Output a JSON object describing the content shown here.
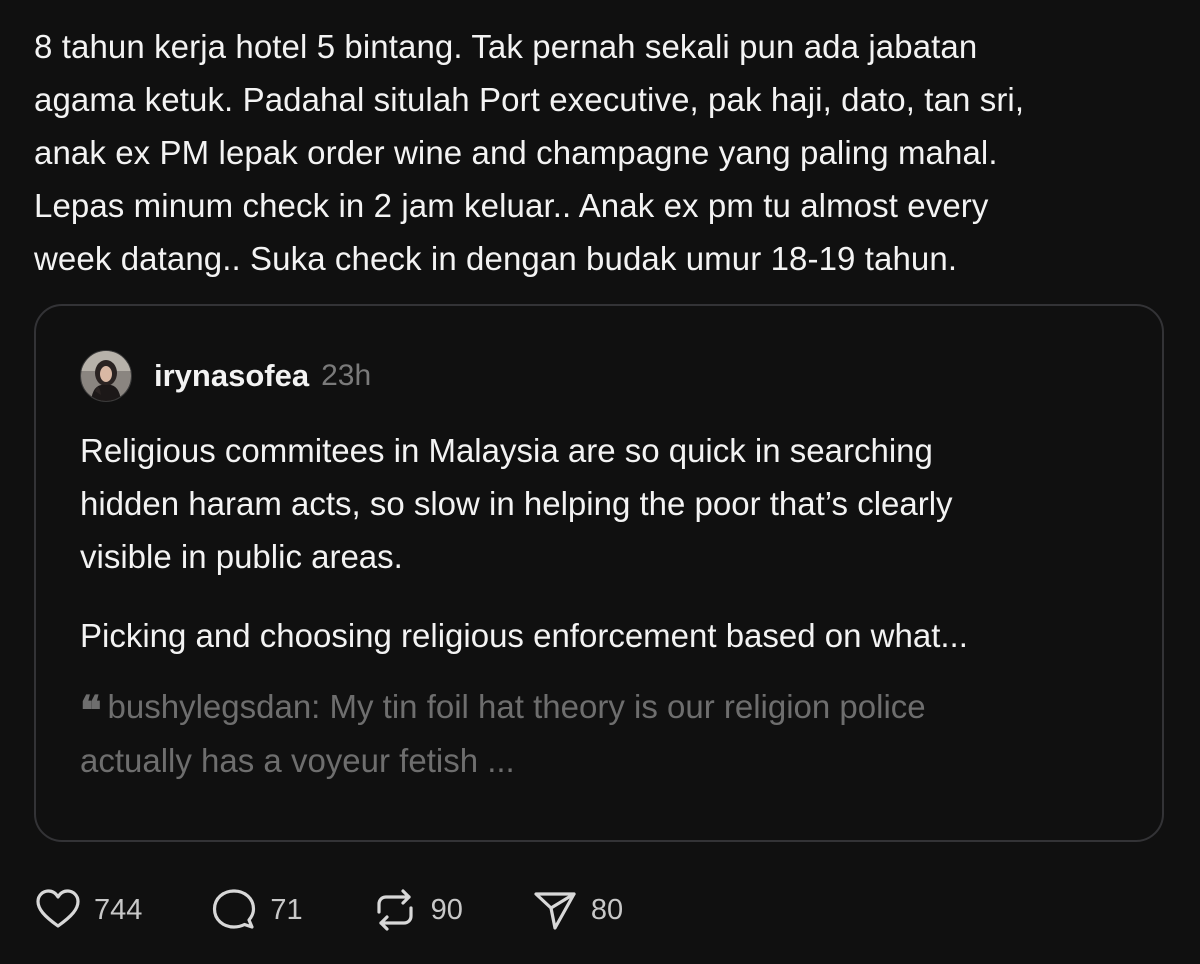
{
  "post": {
    "text": "8 tahun kerja hotel 5 bintang. Tak pernah sekali pun ada jabatan\nagama ketuk. Padahal situlah Port executive, pak haji, dato, tan sri,\nanak ex PM lepak order wine and champagne yang paling mahal.\nLepas minum check in 2 jam keluar.. Anak ex pm tu almost every\nweek datang.. Suka check in dengan budak umur 18-19 tahun."
  },
  "quoted_post": {
    "username": "irynasofea",
    "timestamp": "23h",
    "paragraphs": [
      "Religious commitees in Malaysia are so quick in searching\nhidden haram acts, so slow in helping the poor that’s clearly\nvisible in public areas.",
      "Picking and choosing religious enforcement based on what..."
    ],
    "nested_quote": "bushylegsdan: My tin foil hat theory is our religion police\nactually has a voyeur fetish ..."
  },
  "actions": {
    "like_count": "744",
    "reply_count": "71",
    "repost_count": "90",
    "share_count": "80"
  },
  "colors": {
    "background": "#101010",
    "text": "#f3f3f3",
    "muted": "#7a7a7a",
    "card_border": "#333336"
  },
  "icons": [
    "heart-icon",
    "reply-icon",
    "repost-icon",
    "send-icon",
    "quote-icon"
  ]
}
